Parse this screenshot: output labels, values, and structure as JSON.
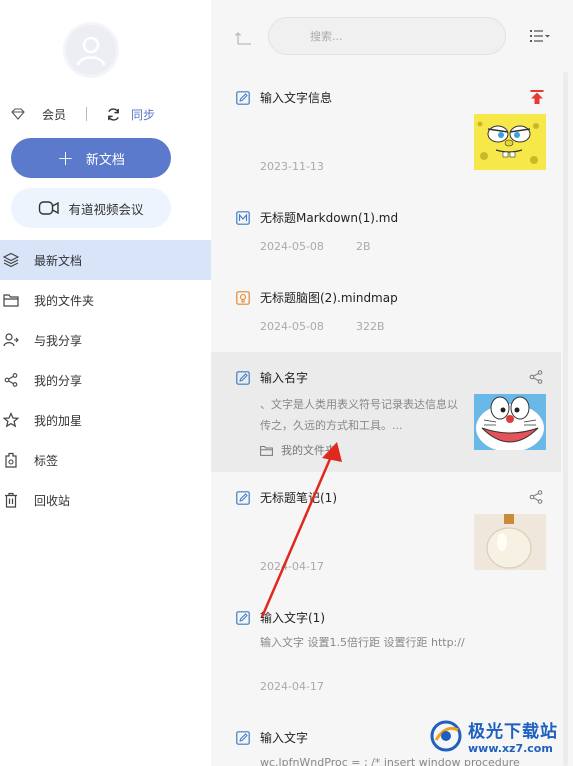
{
  "sidebar": {
    "member_label": "会员",
    "sync_label": "同步",
    "new_doc_label": "新文档",
    "meeting_label": "有道视频会议",
    "nav": [
      {
        "label": "最新文档",
        "icon": "layers-icon",
        "active": true
      },
      {
        "label": "我的文件夹",
        "icon": "folder-icon",
        "active": false
      },
      {
        "label": "与我分享",
        "icon": "shared-with-me-icon",
        "active": false
      },
      {
        "label": "我的分享",
        "icon": "share-icon",
        "active": false
      },
      {
        "label": "我的加星",
        "icon": "star-icon",
        "active": false
      },
      {
        "label": "标签",
        "icon": "tag-icon",
        "active": false
      },
      {
        "label": "回收站",
        "icon": "trash-icon",
        "active": false
      }
    ]
  },
  "toolbar": {
    "search_placeholder": "搜索..."
  },
  "documents": [
    {
      "title": "输入文字信息",
      "date": "2023-11-13",
      "size": "",
      "icon": "note-icon",
      "pinned": true,
      "thumb": "spongebob"
    },
    {
      "title": "无标题Markdown(1).md",
      "date": "2024-05-08",
      "size": "2B",
      "icon": "markdown-icon"
    },
    {
      "title": "无标题脑图(2).mindmap",
      "date": "2024-05-08",
      "size": "322B",
      "icon": "mindmap-icon"
    },
    {
      "title": "输入名字",
      "snippet": "、文字是人类用表义符号记录表达信息以传之，久远的方式和工具。...",
      "folder": "我的文件夹",
      "icon": "note-icon",
      "shared": true,
      "thumb": "doraemon"
    },
    {
      "title": "无标题笔记(1)",
      "date": "2024-04-17",
      "icon": "note-icon",
      "shared": true,
      "thumb": "bottle"
    },
    {
      "title": "输入文字(1)",
      "snippet": "输入文字 设置1.5倍行距 设置行距 http://",
      "date": "2024-04-17",
      "icon": "note-icon"
    },
    {
      "title": "输入文字",
      "snippet": "wc.lpfnWndProc = ; /* insert window procedure",
      "icon": "note-icon"
    }
  ],
  "watermark": {
    "title": "极光下载站",
    "url": "www.xz7.com"
  },
  "colors": {
    "accent": "#5b7acc",
    "active_nav": "#d8e4f8",
    "pin_red": "#e53935",
    "arrow_red": "#e0281e"
  }
}
